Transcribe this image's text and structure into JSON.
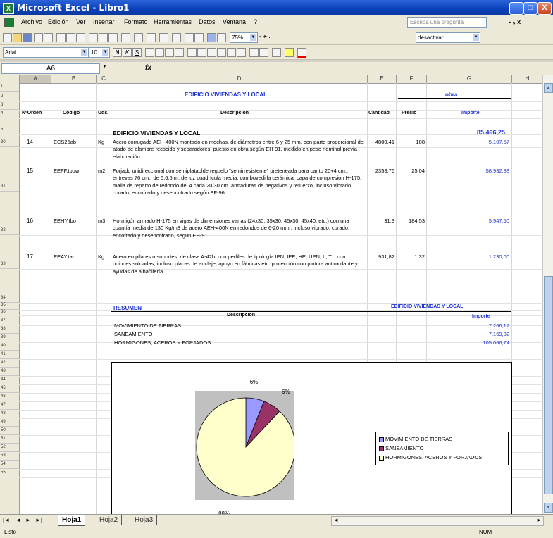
{
  "window": {
    "title": "Microsoft Excel - Libro1",
    "controls": {
      "minimize": "_",
      "maximize": "□",
      "close": "X"
    }
  },
  "menubar": {
    "items": [
      "Archivo",
      "Edición",
      "Ver",
      "Insertar",
      "Formato",
      "Herramientas",
      "Datos",
      "Ventana",
      "?"
    ],
    "help_placeholder": "Escriba una pregunta",
    "doc_controls": "- ₅ x"
  },
  "toolbar": {
    "zoom": "75%",
    "zoom_extra": "- ⚹ .",
    "toolbar_dropdown": "desactivar"
  },
  "format_toolbar": {
    "font": "Arial",
    "size": "10"
  },
  "formula_bar": {
    "name_box": "A6",
    "fx": "fx",
    "content": ""
  },
  "columns": [
    "A",
    "B",
    "C",
    "D",
    "E",
    "F",
    "G",
    "H"
  ],
  "rows": [
    "1",
    "2",
    "3",
    "4",
    "5",
    "30",
    "31",
    "32",
    "33",
    "34",
    "35",
    "36",
    "37",
    "38",
    "39",
    "40",
    "41",
    "42",
    "43",
    "44",
    "45",
    "46",
    "47",
    "48",
    "49",
    "50",
    "51",
    "52",
    "53",
    "54",
    "55"
  ],
  "sheet": {
    "title": "EDIFICIO VIVIENDAS Y LOCAL",
    "obra": "obra",
    "headers": {
      "order": "NºOrden",
      "code": "Código",
      "unit": "Uds.",
      "description": "Descripción",
      "quantity": "Cantidad",
      "price": "Precio",
      "amount": "Importe"
    },
    "section_title": "EDIFICIO VIVIENDAS Y LOCAL",
    "section_total": "85.496,25",
    "items": [
      {
        "order": "14",
        "code": "ECS25ab",
        "unit": "Kg",
        "description": "Acero corrugado AEH-400N montado en mochas, de diámetros entre 6 y 25 mm, con parte proporcional de atado de alambre recocido y separadores, puesto en obra según EH-91, medido en peso nominal previa elaboración.",
        "quantity": "4800,41",
        "price": "108",
        "amount": "5.107,57"
      },
      {
        "order": "15",
        "code": "EEFF.tbow",
        "unit": "m2",
        "description": "Forjado unidireccional con semiplatablde reguelo \"semirresistente\" preteneada para canto 20+4 cm., entrevas 76 cm., de 5.6.5 m. de luz cuadrícula media, con bovedilla cerámica, capa de compresión H-175, malla de reparto de redondo del 4 cada 20/30 cm. armaduras de negativos y refuerzo, incluso vibrado, curado, encofrado y desencofrado según EF-96.",
        "quantity": "2353,76",
        "price": "25,04",
        "amount": "58.932,88"
      },
      {
        "order": "16",
        "code": "EEHY.tbo",
        "unit": "m3",
        "description": "Hormigón armado H-175 en vigas de dimensiones varias (24x30, 35x30, 45x30, 45x40, etc.) con una cuantía media de 130 Kg/m3 de acero AEH-400N en redondos de 6-20 mm., incluso vibrado, curado, encofrado y desencofrado, según EH-91.",
        "quantity": "31,3",
        "price": "184,53",
        "amount": "5.947,50"
      },
      {
        "order": "17",
        "code": "EEAY.tab",
        "unit": "Kg",
        "description": "Acero en pilares o soportes, de clase A-42b, con perfiles de tipología IPN, IPE, HE, UPN, L, T... con uniones soldadas, incluso placas de anclaje, apoyo en fábricas etc. protección con pintura antioxidante y ayudas de albañilería.",
        "quantity": "931,82",
        "price": "1,32",
        "amount": "1.230,00"
      }
    ],
    "summary": {
      "title": "RESUMEN",
      "right_title": "EDIFICIO VIVIENDAS Y LOCAL",
      "desc_header": "Descripción",
      "amount_header": "Importe",
      "rows": [
        {
          "label": "MOVIMIENTO DE TIERRAS",
          "amount": "7.266,17"
        },
        {
          "label": "SANEAMIENTO",
          "amount": "7.169,32"
        },
        {
          "label": "HORMIGONES, ACEROS Y FORJADOS",
          "amount": "105.066,74"
        }
      ]
    }
  },
  "chart_data": {
    "type": "pie",
    "categories": [
      "MOVIMIENTO DE TIERRAS",
      "SANEAMIENTO",
      "HORMIGONES, ACEROS Y FORJADOS"
    ],
    "values": [
      6,
      6,
      88
    ],
    "labels": [
      "6%",
      "6%",
      "88%"
    ],
    "colors": [
      "#9999ff",
      "#993366",
      "#ffffcc"
    ],
    "legend": "right"
  },
  "tabs": {
    "nav": [
      "|◄",
      "◄",
      "►",
      "►|"
    ],
    "sheets": [
      "Hoja1",
      "Hoja2",
      "Hoja3"
    ],
    "active": "Hoja1"
  },
  "status": {
    "left": "Listo",
    "right": "NUM"
  }
}
